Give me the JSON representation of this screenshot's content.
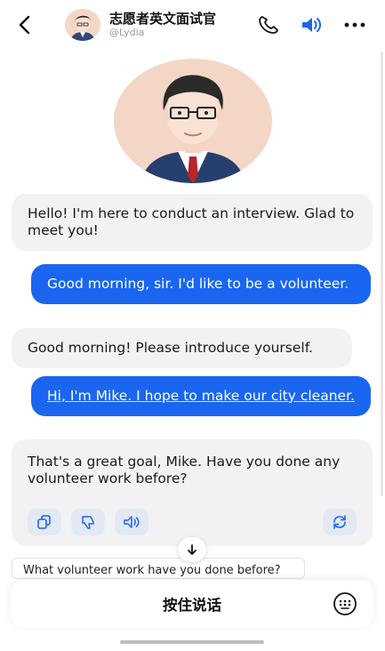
{
  "header": {
    "title": "志愿者英文面试官",
    "subtitle": "@Lydia"
  },
  "messages": [
    {
      "role": "bot",
      "text": "Hello! I'm here to conduct an interview. Glad to meet you!"
    },
    {
      "role": "user",
      "text": "Good morning, sir. I'd like to be a volunteer."
    },
    {
      "role": "bot",
      "text": "Good morning! Please introduce yourself."
    },
    {
      "role": "user",
      "text": "Hi, I'm Mike. I hope to make our city cleaner."
    },
    {
      "role": "bot",
      "text": "That's a great goal, Mike. Have you done any volunteer work before?"
    }
  ],
  "message_actions": [
    "copy-icon",
    "thumbs-down-icon",
    "speaker-icon",
    "regenerate-icon"
  ],
  "suggestion": "What volunteer work have you done before?",
  "input": {
    "hold_to_talk_label": "按住说话"
  },
  "colors": {
    "user_bubble": "#1a66f0",
    "bot_bubble": "#f2f2f4",
    "accent": "#1a66f0"
  }
}
